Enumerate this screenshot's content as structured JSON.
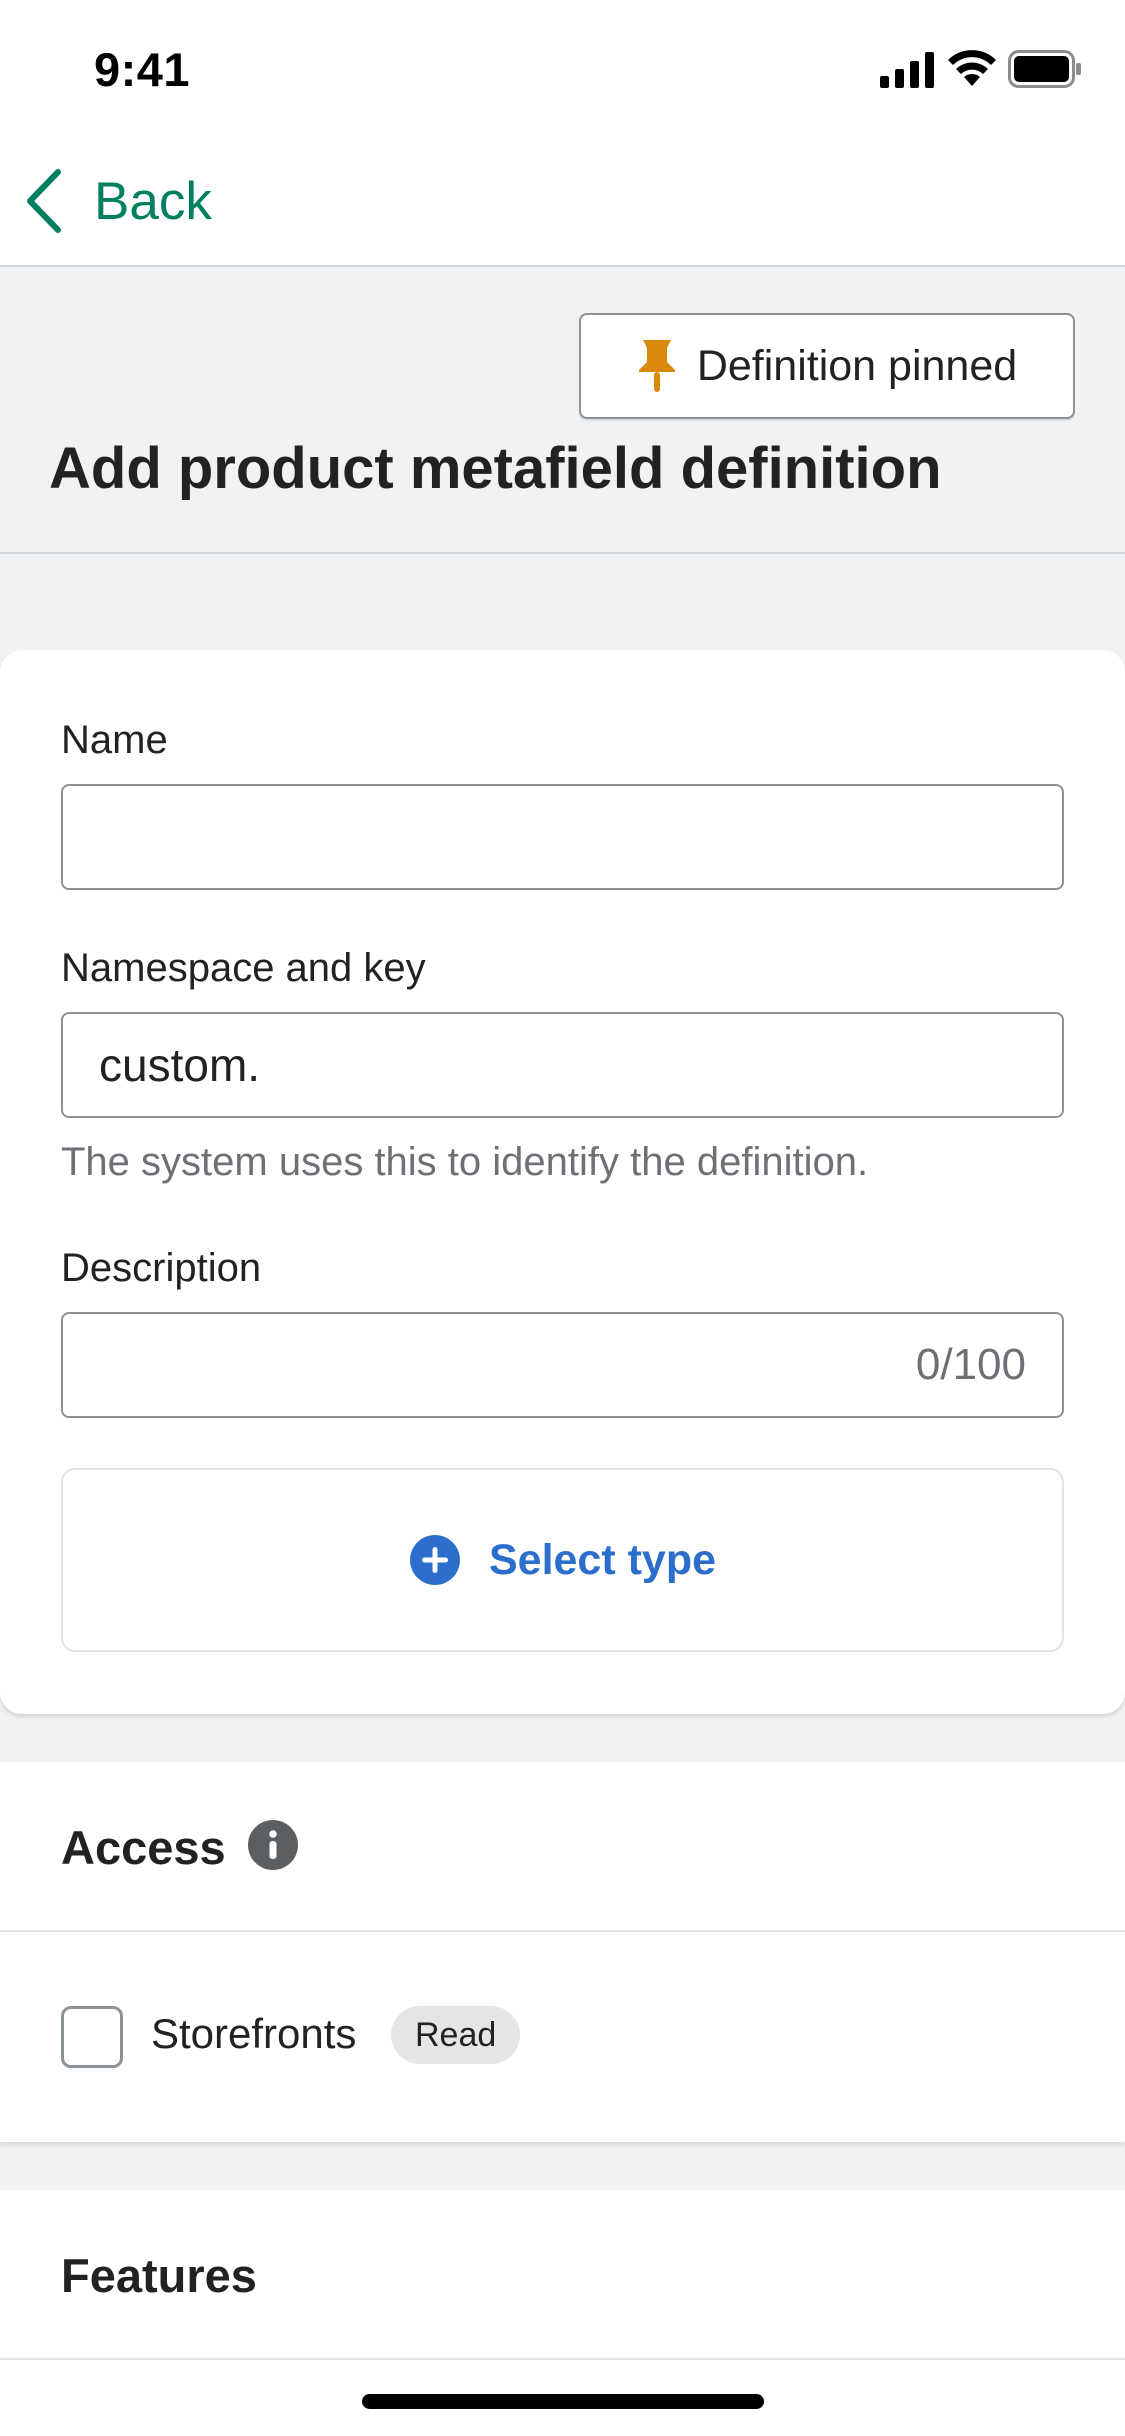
{
  "status_bar": {
    "time": "9:41",
    "icons": [
      "signal-icon",
      "wifi-icon",
      "battery-icon"
    ]
  },
  "nav": {
    "back_label": "Back",
    "icon": "chevron-left-icon"
  },
  "header": {
    "pin_button_label": "Definition pinned",
    "pin_icon": "pushpin-icon",
    "title": "Add product metafield definition"
  },
  "form": {
    "name_label": "Name",
    "name_value": "",
    "namespace_label": "Namespace and key",
    "namespace_value": "custom.",
    "namespace_help": "The system uses this to identify the definition.",
    "description_label": "Description",
    "description_value": "",
    "description_counter": "0/100",
    "select_type_label": "Select type",
    "select_type_icon": "plus-circle-icon"
  },
  "access": {
    "title": "Access",
    "info_icon": "info-icon",
    "storefronts_label": "Storefronts",
    "storefronts_checked": false,
    "storefronts_badge": "Read"
  },
  "features": {
    "title": "Features"
  },
  "colors": {
    "brand_green": "#008060",
    "action_blue": "#2c6ecb",
    "pin_orange": "#d98a0b",
    "page_background": "#f1f2f4"
  }
}
